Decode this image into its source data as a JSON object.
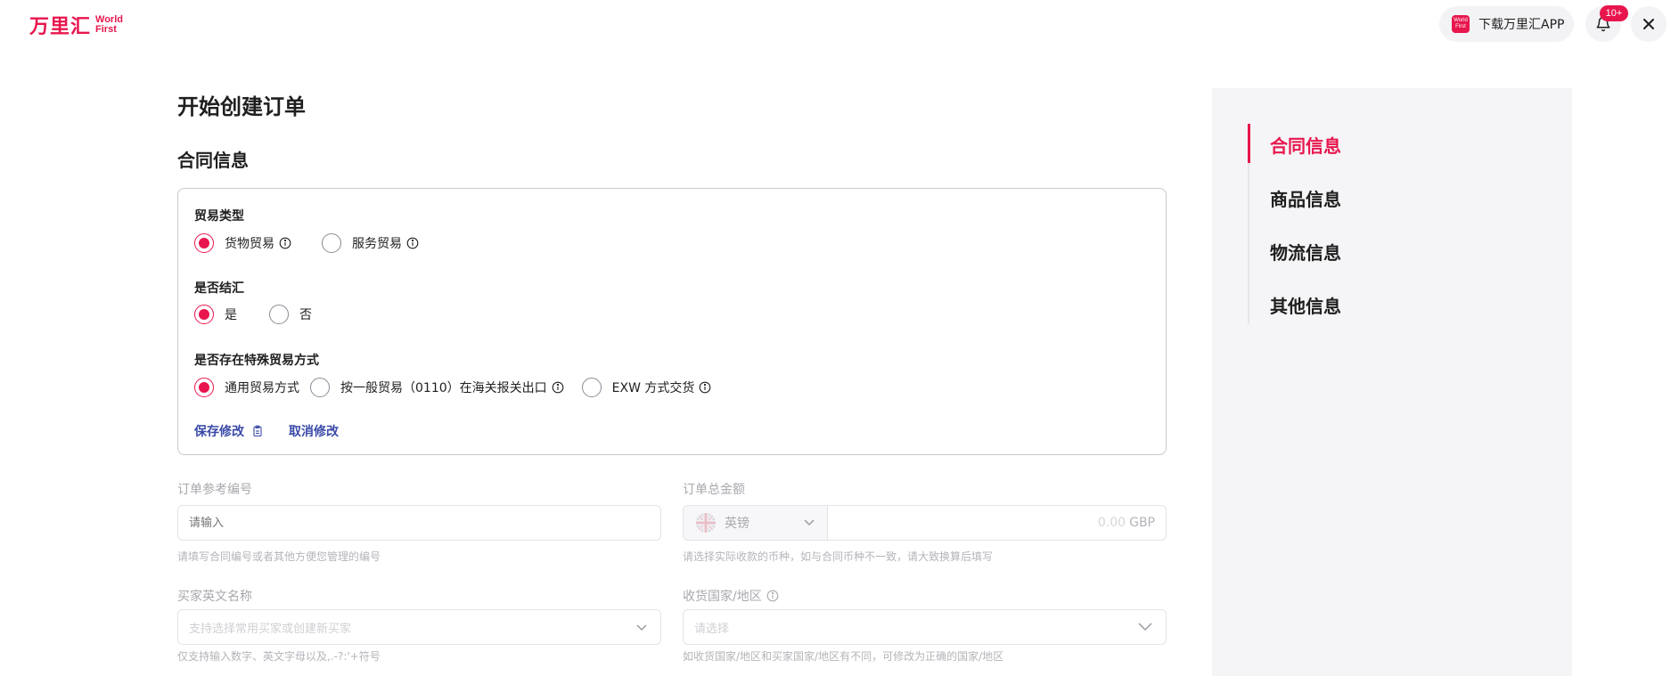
{
  "header": {
    "logo_cn": "万里汇",
    "logo_en_line1": "World",
    "logo_en_line2": "First",
    "app_icon_text": "World First",
    "download_app": "下载万里汇APP",
    "notification_badge": "10+"
  },
  "page": {
    "title": "开始创建订单",
    "section_title": "合同信息"
  },
  "contract": {
    "trade_type": {
      "label": "贸易类型",
      "options": [
        {
          "label": "货物贸易",
          "checked": true,
          "info": true
        },
        {
          "label": "服务贸易",
          "checked": false,
          "info": true
        }
      ]
    },
    "settlement": {
      "label": "是否结汇",
      "options": [
        {
          "label": "是",
          "checked": true
        },
        {
          "label": "否",
          "checked": false
        }
      ]
    },
    "special_trade": {
      "label": "是否存在特殊贸易方式",
      "options": [
        {
          "label": "通用贸易方式",
          "checked": true
        },
        {
          "label": "按一般贸易（0110）在海关报关出口",
          "checked": false,
          "info": true
        },
        {
          "label": "EXW 方式交货",
          "checked": false,
          "info": true
        }
      ]
    },
    "save_label": "保存修改",
    "cancel_label": "取消修改"
  },
  "form": {
    "order_ref": {
      "label": "订单参考编号",
      "placeholder": "请输入",
      "help": "请填写合同编号或者其他方便您管理的编号"
    },
    "order_total": {
      "label": "订单总金额",
      "currency": "英镑",
      "amount_placeholder": "0.00",
      "currency_code": "GBP",
      "help": "请选择实际收款的币种，如与合同币种不一致，请大致换算后填写"
    },
    "buyer_name": {
      "label": "买家英文名称",
      "placeholder": "支持选择常用买家或创建新买家",
      "help": "仅支持输入数字、英文字母以及,.-?:'+符号"
    },
    "ship_country": {
      "label": "收货国家/地区",
      "placeholder": "请选择",
      "help": "如收货国家/地区和买家国家/地区有不同，可修改为正确的国家/地区"
    }
  },
  "side_nav": {
    "items": [
      {
        "label": "合同信息",
        "active": true
      },
      {
        "label": "商品信息",
        "active": false
      },
      {
        "label": "物流信息",
        "active": false
      },
      {
        "label": "其他信息",
        "active": false
      }
    ]
  },
  "colors": {
    "brand": "#e8164d",
    "link": "#3a4aa8",
    "side_bg": "#f5f5f7"
  }
}
